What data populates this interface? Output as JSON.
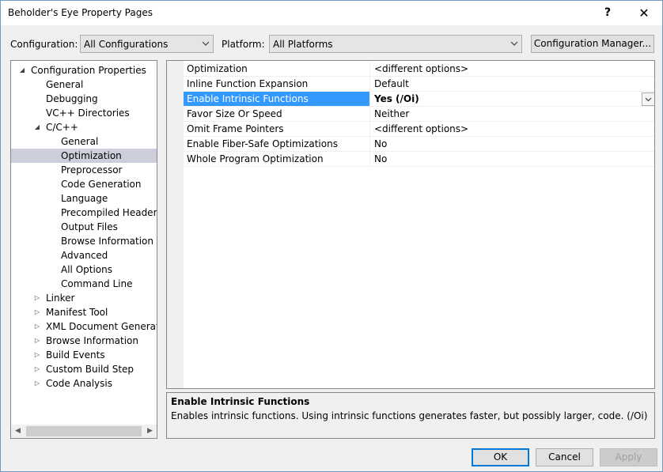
{
  "window": {
    "title": "Beholder's Eye Property Pages",
    "help_label": "?",
    "close_label": "✕"
  },
  "toolbar": {
    "configuration_label": "Configuration:",
    "configuration_value": "All Configurations",
    "platform_label": "Platform:",
    "platform_value": "All Platforms",
    "config_manager_label": "Configuration Manager..."
  },
  "tree": {
    "items": [
      {
        "label": "Configuration Properties",
        "glyph": "◢"
      },
      {
        "label": "General",
        "glyph": ""
      },
      {
        "label": "Debugging",
        "glyph": ""
      },
      {
        "label": "VC++ Directories",
        "glyph": ""
      },
      {
        "label": "C/C++",
        "glyph": "◢"
      },
      {
        "label": "General",
        "glyph": ""
      },
      {
        "label": "Optimization",
        "glyph": ""
      },
      {
        "label": "Preprocessor",
        "glyph": ""
      },
      {
        "label": "Code Generation",
        "glyph": ""
      },
      {
        "label": "Language",
        "glyph": ""
      },
      {
        "label": "Precompiled Headers",
        "glyph": ""
      },
      {
        "label": "Output Files",
        "glyph": ""
      },
      {
        "label": "Browse Information",
        "glyph": ""
      },
      {
        "label": "Advanced",
        "glyph": ""
      },
      {
        "label": "All Options",
        "glyph": ""
      },
      {
        "label": "Command Line",
        "glyph": ""
      },
      {
        "label": "Linker",
        "glyph": "▷"
      },
      {
        "label": "Manifest Tool",
        "glyph": "▷"
      },
      {
        "label": "XML Document Generator",
        "glyph": "▷"
      },
      {
        "label": "Browse Information",
        "glyph": "▷"
      },
      {
        "label": "Build Events",
        "glyph": "▷"
      },
      {
        "label": "Custom Build Step",
        "glyph": "▷"
      },
      {
        "label": "Code Analysis",
        "glyph": "▷"
      }
    ],
    "scroll_left": "◀",
    "scroll_right": "▶"
  },
  "properties": [
    {
      "name": "Optimization",
      "value": "<different options>"
    },
    {
      "name": "Inline Function Expansion",
      "value": "Default"
    },
    {
      "name": "Enable Intrinsic Functions",
      "value": "Yes (/Oi)"
    },
    {
      "name": "Favor Size Or Speed",
      "value": "Neither"
    },
    {
      "name": "Omit Frame Pointers",
      "value": "<different options>"
    },
    {
      "name": "Enable Fiber-Safe Optimizations",
      "value": "No"
    },
    {
      "name": "Whole Program Optimization",
      "value": "No"
    }
  ],
  "description": {
    "title": "Enable Intrinsic Functions",
    "text": "Enables intrinsic functions.  Using intrinsic functions generates faster, but possibly larger, code.     (/Oi)"
  },
  "buttons": {
    "ok": "OK",
    "cancel": "Cancel",
    "apply": "Apply"
  }
}
